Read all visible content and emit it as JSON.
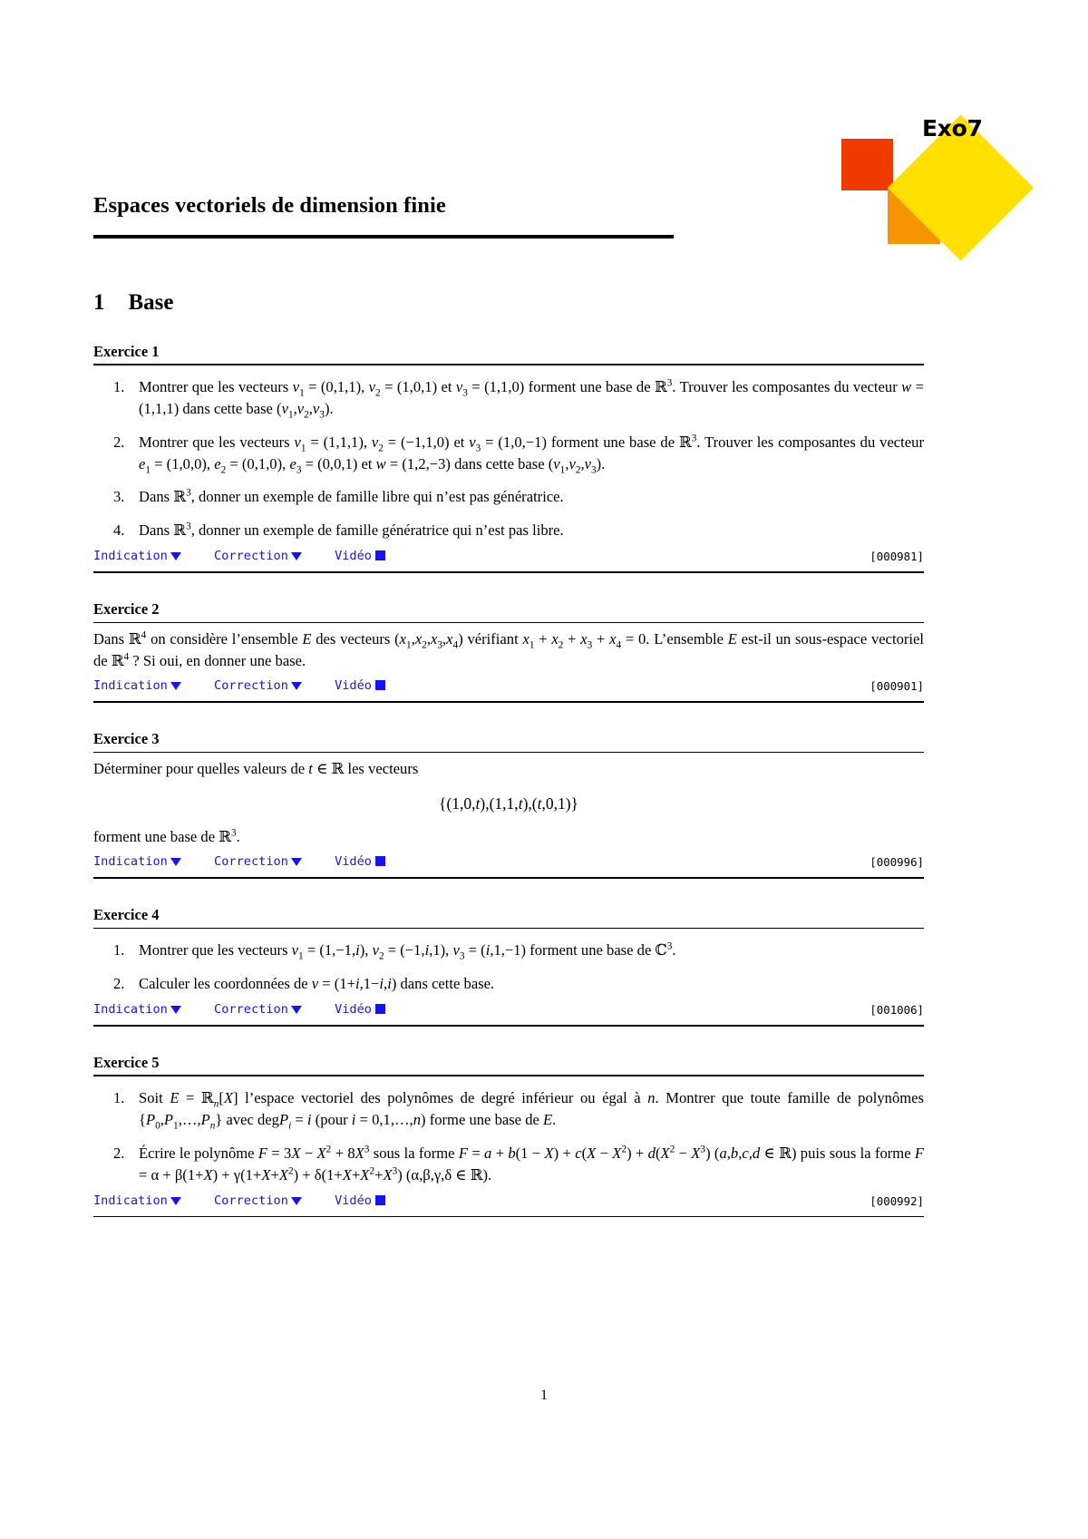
{
  "logo": {
    "text": "Exo7",
    "yellow": "#ffe000",
    "red": "#ef3b00",
    "orange": "#f79500"
  },
  "document": {
    "title": "Espaces vectoriels de dimension finie",
    "page_number": "1"
  },
  "section": {
    "number": "1",
    "title": "Base"
  },
  "link_labels": {
    "indication": "Indication",
    "correction": "Correction",
    "video": "Vidéo"
  },
  "exercises": [
    {
      "heading": "Exercice 1",
      "id": "[000981]",
      "items": [
        "Montrer que les vecteurs v₁ = (0,1,1), v₂ = (1,0,1) et v₃ = (1,1,0) forment une base de ℝ³. Trouver les composantes du vecteur w = (1,1,1) dans cette base (v₁,v₂,v₃).",
        "Montrer que les vecteurs v₁ = (1,1,1), v₂ = (−1,1,0) et v₃ = (1,0,−1) forment une base de ℝ³. Trouver les composantes du vecteur e₁ = (1,0,0), e₂ = (0,1,0), e₃ = (0,0,1) et w = (1,2,−3) dans cette base (v₁,v₂,v₃).",
        "Dans ℝ³, donner un exemple de famille libre qui n'est pas génératrice.",
        "Dans ℝ³, donner un exemple de famille génératrice qui n'est pas libre."
      ]
    },
    {
      "heading": "Exercice 2",
      "id": "[000901]",
      "body": "Dans ℝ⁴ on considère l'ensemble E des vecteurs (x₁,x₂,x₃,x₄) vérifiant x₁ + x₂ + x₃ + x₄ = 0. L'ensemble E est-il un sous-espace vectoriel de ℝ⁴ ? Si oui, en donner une base."
    },
    {
      "heading": "Exercice 3",
      "id": "[000996]",
      "body_before": "Déterminer pour quelles valeurs de t ∈ ℝ les vecteurs",
      "display": "{(1,0,t),(1,1,t),(t,0,1)}",
      "body_after": "forment une base de ℝ³."
    },
    {
      "heading": "Exercice 4",
      "id": "[001006]",
      "items": [
        "Montrer que les vecteurs v₁ = (1,−1,i), v₂ = (−1,i,1), v₃ = (i,1,−1) forment une base de ℂ³.",
        "Calculer les coordonnées de v = (1+i,1−i,i) dans cette base."
      ]
    },
    {
      "heading": "Exercice 5",
      "id": "[000992]",
      "items": [
        "Soit E = ℝₙ[X] l'espace vectoriel des polynômes de degré inférieur ou égal à n. Montrer que toute famille de polynômes {P₀,P₁,…,Pₙ} avec deg Pᵢ = i (pour i = 0,1,…,n) forme une base de E.",
        "Écrire le polynôme F = 3X − X² + 8X³ sous la forme F = a + b(1−X) + c(X−X²) + d(X²−X³) (a,b,c,d ∈ ℝ) puis sous la forme F = α + β(1+X) + γ(1+X+X²) + δ(1+X+X²+X³) (α,β,γ,δ ∈ ℝ)."
      ]
    }
  ]
}
